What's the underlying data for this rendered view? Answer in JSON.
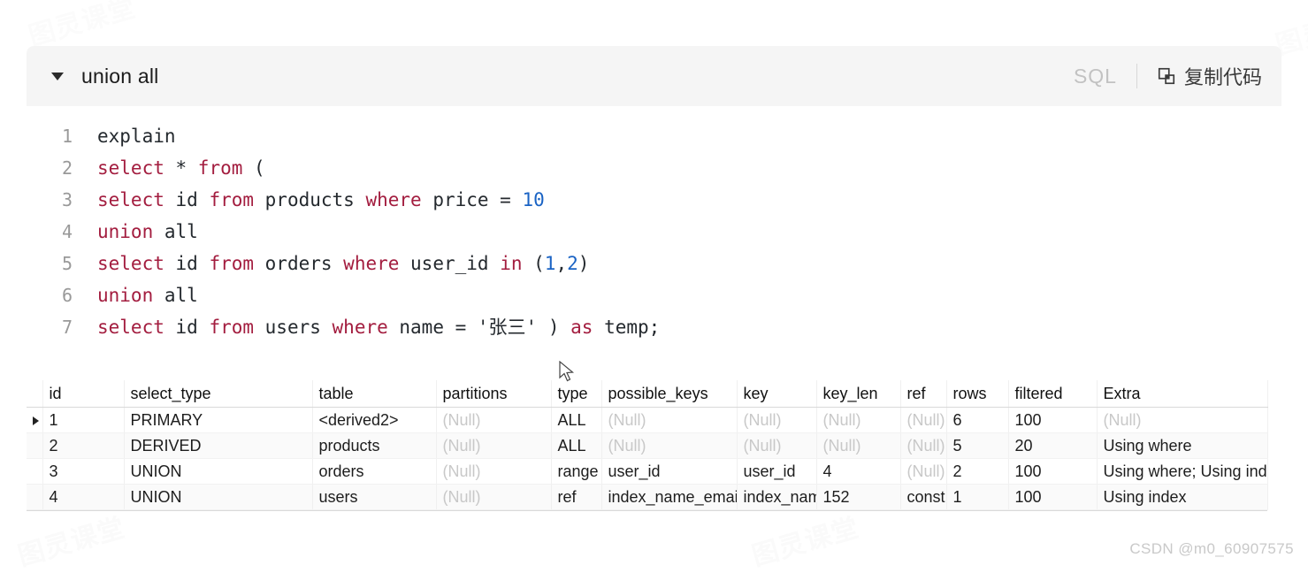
{
  "code_card": {
    "title": "union all",
    "language_label": "SQL",
    "copy_label": "复制代码",
    "collapse_icon": "triangle-down-icon",
    "copy_icon": "copy-icon",
    "lines": [
      {
        "n": "1",
        "tokens": [
          {
            "t": "explain",
            "c": "code-text"
          }
        ]
      },
      {
        "n": "2",
        "tokens": [
          {
            "t": "select",
            "c": "kw"
          },
          {
            "t": " * ",
            "c": "code-text"
          },
          {
            "t": "from",
            "c": "kw"
          },
          {
            "t": " (",
            "c": "code-text"
          }
        ]
      },
      {
        "n": "3",
        "tokens": [
          {
            "t": "select",
            "c": "kw"
          },
          {
            "t": " id ",
            "c": "code-text"
          },
          {
            "t": "from",
            "c": "kw"
          },
          {
            "t": " products ",
            "c": "code-text"
          },
          {
            "t": "where",
            "c": "kw"
          },
          {
            "t": " price = ",
            "c": "code-text"
          },
          {
            "t": "10",
            "c": "num"
          }
        ]
      },
      {
        "n": "4",
        "tokens": [
          {
            "t": "union",
            "c": "kw"
          },
          {
            "t": " all",
            "c": "code-text"
          }
        ]
      },
      {
        "n": "5",
        "tokens": [
          {
            "t": "select",
            "c": "kw"
          },
          {
            "t": " id ",
            "c": "code-text"
          },
          {
            "t": "from",
            "c": "kw"
          },
          {
            "t": " orders ",
            "c": "code-text"
          },
          {
            "t": "where",
            "c": "kw"
          },
          {
            "t": " user_id ",
            "c": "code-text"
          },
          {
            "t": "in",
            "c": "kw"
          },
          {
            "t": " (",
            "c": "code-text"
          },
          {
            "t": "1",
            "c": "num"
          },
          {
            "t": ",",
            "c": "code-text"
          },
          {
            "t": "2",
            "c": "num"
          },
          {
            "t": ")",
            "c": "code-text"
          }
        ]
      },
      {
        "n": "6",
        "tokens": [
          {
            "t": "union",
            "c": "kw"
          },
          {
            "t": " all",
            "c": "code-text"
          }
        ]
      },
      {
        "n": "7",
        "tokens": [
          {
            "t": "select",
            "c": "kw"
          },
          {
            "t": " id ",
            "c": "code-text"
          },
          {
            "t": "from",
            "c": "kw"
          },
          {
            "t": " users ",
            "c": "code-text"
          },
          {
            "t": "where",
            "c": "kw"
          },
          {
            "t": " name = ",
            "c": "code-text"
          },
          {
            "t": "'张三'",
            "c": "str"
          },
          {
            "t": " ) ",
            "c": "code-text"
          },
          {
            "t": "as",
            "c": "kw"
          },
          {
            "t": " temp;",
            "c": "code-text"
          }
        ]
      }
    ]
  },
  "result_grid": {
    "columns": [
      "id",
      "select_type",
      "table",
      "partitions",
      "type",
      "possible_keys",
      "key",
      "key_len",
      "ref",
      "rows",
      "filtered",
      "Extra"
    ],
    "selected_column": "id",
    "selected_row_index": 0,
    "rows": [
      {
        "id": "1",
        "select_type": "PRIMARY",
        "table": "<derived2>",
        "partitions": "(Null)",
        "type": "ALL",
        "possible_keys": "(Null)",
        "key": "(Null)",
        "key_len": "(Null)",
        "ref": "(Null)",
        "rows": "6",
        "filtered": "100",
        "extra": "(Null)"
      },
      {
        "id": "2",
        "select_type": "DERIVED",
        "table": "products",
        "partitions": "(Null)",
        "type": "ALL",
        "possible_keys": "(Null)",
        "key": "(Null)",
        "key_len": "(Null)",
        "ref": "(Null)",
        "rows": "5",
        "filtered": "20",
        "extra": "Using where"
      },
      {
        "id": "3",
        "select_type": "UNION",
        "table": "orders",
        "partitions": "(Null)",
        "type": "range",
        "possible_keys": "user_id",
        "key": "user_id",
        "key_len": "4",
        "ref": "(Null)",
        "rows": "2",
        "filtered": "100",
        "extra": "Using where; Using index"
      },
      {
        "id": "4",
        "select_type": "UNION",
        "table": "users",
        "partitions": "(Null)",
        "type": "ref",
        "possible_keys": "index_name_emai",
        "key": "index_nam",
        "key_len": "152",
        "ref": "const",
        "rows": "1",
        "filtered": "100",
        "extra": "Using index"
      }
    ]
  },
  "watermarks": {
    "text": "图灵课堂"
  },
  "footer": {
    "credit": "CSDN @m0_60907575"
  },
  "colors": {
    "keyword": "#a31d3f",
    "number": "#1a63c4",
    "header_bg": "#f5f5f5",
    "selected_col_bg": "#dbe9f7"
  }
}
